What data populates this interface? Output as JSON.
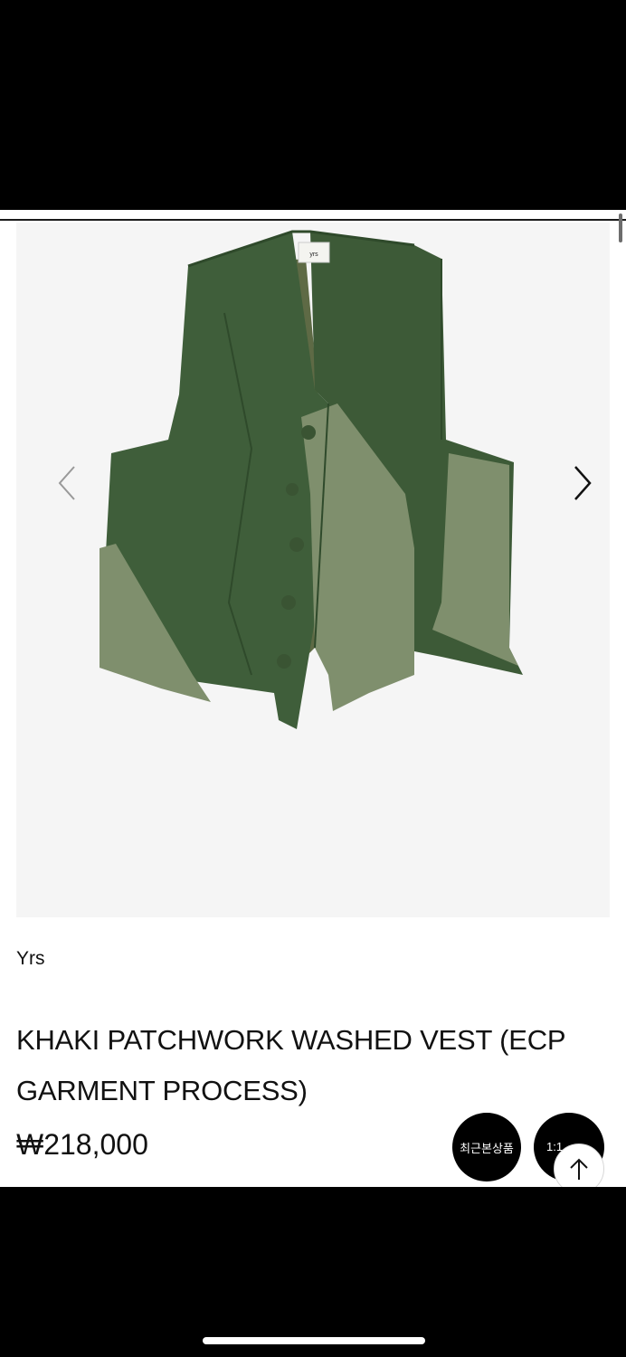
{
  "product": {
    "brand": "Yrs",
    "title": "KHAKI PATCHWORK WASHED VEST (ECP GARMENT PROCESS)",
    "price": "₩218,000",
    "label_tag": "yrs"
  },
  "floating": {
    "recent_label": "최근본상품",
    "chat_label": "1:1"
  },
  "icons": {
    "prev": "chevron-left-icon",
    "next": "chevron-right-icon",
    "top": "arrow-up-icon"
  },
  "colors": {
    "vest_dark": "#3f5e3a",
    "vest_light": "#7f8f6d",
    "gallery_bg": "#f5f5f5"
  }
}
